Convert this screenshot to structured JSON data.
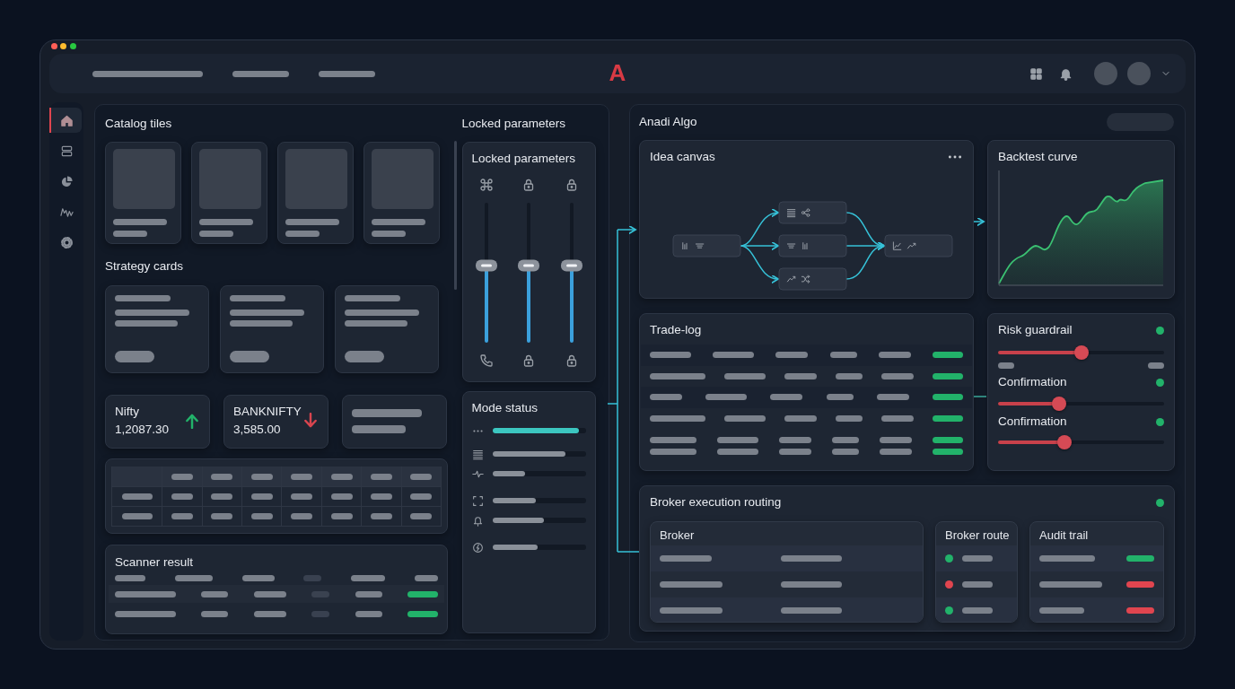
{
  "window": {
    "controls": [
      {
        "color": "#ff5f57"
      },
      {
        "color": "#febc2e"
      },
      {
        "color": "#28c840"
      }
    ]
  },
  "top_bar": {
    "logo": "A"
  },
  "sidebar": {
    "items": [
      {
        "selected": true
      },
      {
        "selected": false
      },
      {
        "selected": false
      },
      {
        "selected": false
      },
      {
        "selected": false
      }
    ]
  },
  "catalog": {
    "title": "Catalog tiles"
  },
  "strategy": {
    "title": "Strategy cards"
  },
  "tickers": [
    {
      "name": "Nifty",
      "value": "1,2087.30",
      "rising": true
    },
    {
      "name": "BANKNIFTY",
      "value": "3,585.00",
      "rising": false
    }
  ],
  "scanner": {
    "title": "Scanner result"
  },
  "locked_parameters": {
    "section_title": "Locked parameters",
    "title": "Locked parameters",
    "sliders": [
      {
        "level": 0.55
      },
      {
        "level": 0.55
      },
      {
        "level": 0.55
      }
    ]
  },
  "mode_status": {
    "title": "Mode status",
    "rows": [
      {
        "level": 0.92,
        "highlighted": true
      },
      {
        "level": 0.78,
        "highlighted": false
      },
      {
        "level": 0.35,
        "highlighted": false
      },
      {
        "level": 0.46,
        "highlighted": false
      },
      {
        "level": 0.55,
        "highlighted": false
      },
      {
        "level": 0.48,
        "highlighted": false
      }
    ]
  },
  "main_panel": {
    "title": "Anadi Algo"
  },
  "idea_canvas": {
    "title": "Idea canvas"
  },
  "backtest": {
    "title": "Backtest curve"
  },
  "trade_log": {
    "title": "Trade-log"
  },
  "risk_guardrail": {
    "title": "Risk guardrail",
    "on": true,
    "level": 0.5,
    "confirmations": [
      {
        "label": "Confirmation",
        "on": true,
        "level": 0.37
      },
      {
        "label": "Confirmation",
        "on": true,
        "level": 0.4
      }
    ]
  },
  "broker_routing": {
    "title": "Broker execution routing",
    "on": true,
    "broker": {
      "title": "Broker"
    },
    "route": {
      "title": "Broker route",
      "rows": [
        {
          "color": "#22b26a"
        },
        {
          "color": "#e0454f"
        },
        {
          "color": "#22b26a"
        }
      ]
    },
    "audit": {
      "title": "Audit trail",
      "rows": [
        {
          "color": "#22b26a"
        },
        {
          "color": "#e0454f"
        },
        {
          "color": "#e0454f"
        }
      ]
    }
  }
}
